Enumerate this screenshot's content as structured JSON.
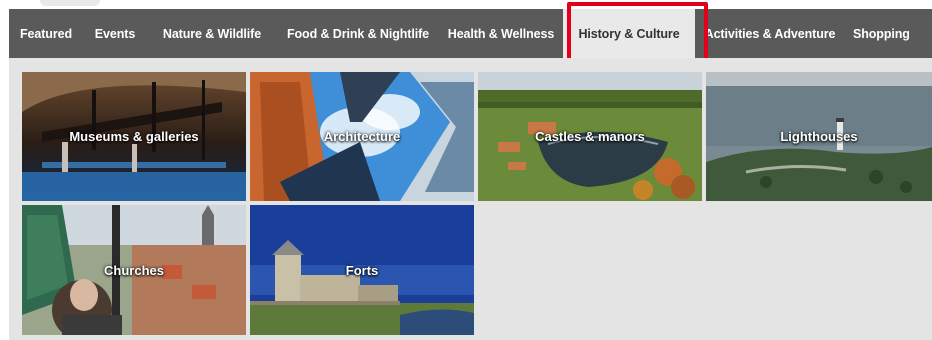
{
  "nav": {
    "items": [
      {
        "label": "Featured"
      },
      {
        "label": "Events"
      },
      {
        "label": "Nature & Wildlife"
      },
      {
        "label": "Food & Drink & Nightlife"
      },
      {
        "label": "Health & Wellness"
      },
      {
        "label": "History & Culture",
        "active": true
      },
      {
        "label": "Activities & Adventure"
      },
      {
        "label": "Shopping"
      }
    ]
  },
  "colors": {
    "nav_bg": "#5a5a5a",
    "nav_active_bg": "#e9e9e9",
    "content_bg": "#e4e4e4",
    "highlight": "#e3001b"
  },
  "tiles": [
    {
      "label": "Museums & galleries"
    },
    {
      "label": "Architecture"
    },
    {
      "label": "Castles & manors"
    },
    {
      "label": "Lighthouses"
    },
    {
      "label": "Churches"
    },
    {
      "label": "Forts"
    }
  ]
}
